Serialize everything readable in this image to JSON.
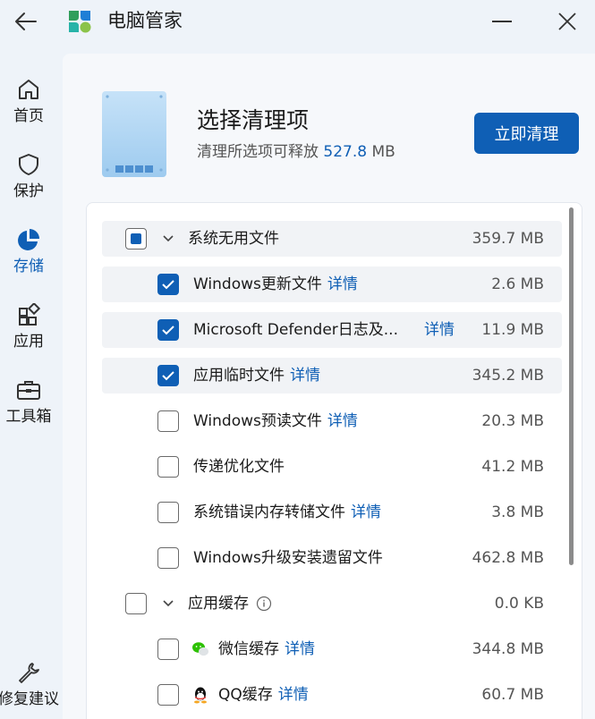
{
  "app": {
    "title": "电脑管家"
  },
  "sidebar": {
    "items": [
      {
        "label": "首页",
        "icon": "home-icon",
        "active": false
      },
      {
        "label": "保护",
        "icon": "shield-icon",
        "active": false
      },
      {
        "label": "存储",
        "icon": "pie-chart-icon",
        "active": true
      },
      {
        "label": "应用",
        "icon": "apps-icon",
        "active": false
      },
      {
        "label": "工具箱",
        "icon": "toolbox-icon",
        "active": false
      }
    ],
    "feedback": {
      "label": "修复建议",
      "icon": "wrench-icon"
    }
  },
  "header": {
    "title": "选择清理项",
    "subtitle_prefix": "清理所选项可释放 ",
    "subtitle_amount": "527.8",
    "subtitle_unit": " MB",
    "clean_button": "立即清理"
  },
  "detail_label": "详情",
  "groups": [
    {
      "name": "系统无用文件",
      "size": "359.7 MB",
      "state": "partial",
      "expanded": true,
      "items": [
        {
          "name": "Windows更新文件",
          "size": "2.6 MB",
          "checked": true,
          "detail": true
        },
        {
          "name": "Microsoft Defender日志及...",
          "size": "11.9 MB",
          "checked": true,
          "detail": true
        },
        {
          "name": "应用临时文件",
          "size": "345.2 MB",
          "checked": true,
          "detail": true
        },
        {
          "name": "Windows预读文件",
          "size": "20.3 MB",
          "checked": false,
          "detail": true
        },
        {
          "name": "传递优化文件",
          "size": "41.2 MB",
          "checked": false,
          "detail": false
        },
        {
          "name": "系统错误内存转储文件",
          "size": "3.8 MB",
          "checked": false,
          "detail": true
        },
        {
          "name": "Windows升级安装遗留文件",
          "size": "462.8 MB",
          "checked": false,
          "detail": false
        }
      ]
    },
    {
      "name": "应用缓存",
      "size": "0.0 KB",
      "state": "unchecked",
      "expanded": true,
      "info_icon": "info-icon",
      "items": [
        {
          "name": "微信缓存",
          "size": "344.8 MB",
          "checked": false,
          "detail": true,
          "icon": "wechat-icon"
        },
        {
          "name": "QQ缓存",
          "size": "60.7 MB",
          "checked": false,
          "detail": true,
          "icon": "qq-icon"
        }
      ]
    }
  ],
  "colors": {
    "accent": "#0f5fb5",
    "background": "#eef3f9",
    "panel": "#f6f8fb"
  }
}
